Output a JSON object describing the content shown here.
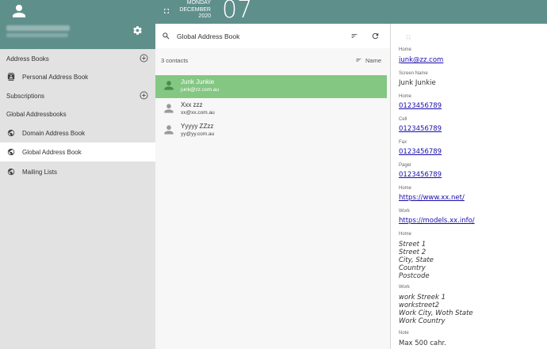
{
  "sidebar": {
    "sections": {
      "address_books": "Address Books",
      "subscriptions": "Subscriptions",
      "global_addressbooks": "Global Addressbooks"
    },
    "items": {
      "personal": "Personal Address Book",
      "domain": "Domain Address Book",
      "global": "Global Address Book",
      "mailing": "Mailing Lists"
    }
  },
  "topbar": {
    "weekday": "MONDAY",
    "month": "DECEMBER",
    "year": "2020",
    "day": "07"
  },
  "list": {
    "title": "Global Address Book",
    "count": "3 contacts",
    "sort_label": "Name",
    "contacts": [
      {
        "name": "Junk Junkie",
        "email": "junk@zz.com.au",
        "selected": true
      },
      {
        "name": "Xxx zzz",
        "email": "xx@xx.com.au",
        "selected": false
      },
      {
        "name": "Yyyyy ZZzz",
        "email": "yy@yy.com.au",
        "selected": false
      }
    ]
  },
  "detail": {
    "email_label": "Home",
    "email": "junk@zz.com",
    "screen_name_label": "Screen Name",
    "screen_name": "Junk Junkie",
    "phone_home_label": "Home",
    "phone_home": "0123456789",
    "cell_label": "Cell",
    "cell": "0123456789",
    "fax_label": "Fax",
    "fax": "0123456789",
    "pager_label": "Pager",
    "pager": "0123456789",
    "url_home_label": "Home",
    "url_home": "https://www.xx.net/",
    "url_work_label": "Work",
    "url_work": "https://models.xx.info/",
    "addr_home_label": "Home",
    "addr_home": [
      "Street 1",
      "Street 2",
      "City, State",
      "Country",
      "Postcode"
    ],
    "addr_work_label": "Work",
    "addr_work": [
      "work Streek 1",
      "workstreet2",
      "Work City, Woth State",
      "Work Country"
    ],
    "note_label": "Note",
    "note": "Max 500 cahr."
  },
  "colors": {
    "header_teal": "#5e8f8b",
    "selected_green": "#84c783",
    "link_blue": "#1a0dab"
  }
}
